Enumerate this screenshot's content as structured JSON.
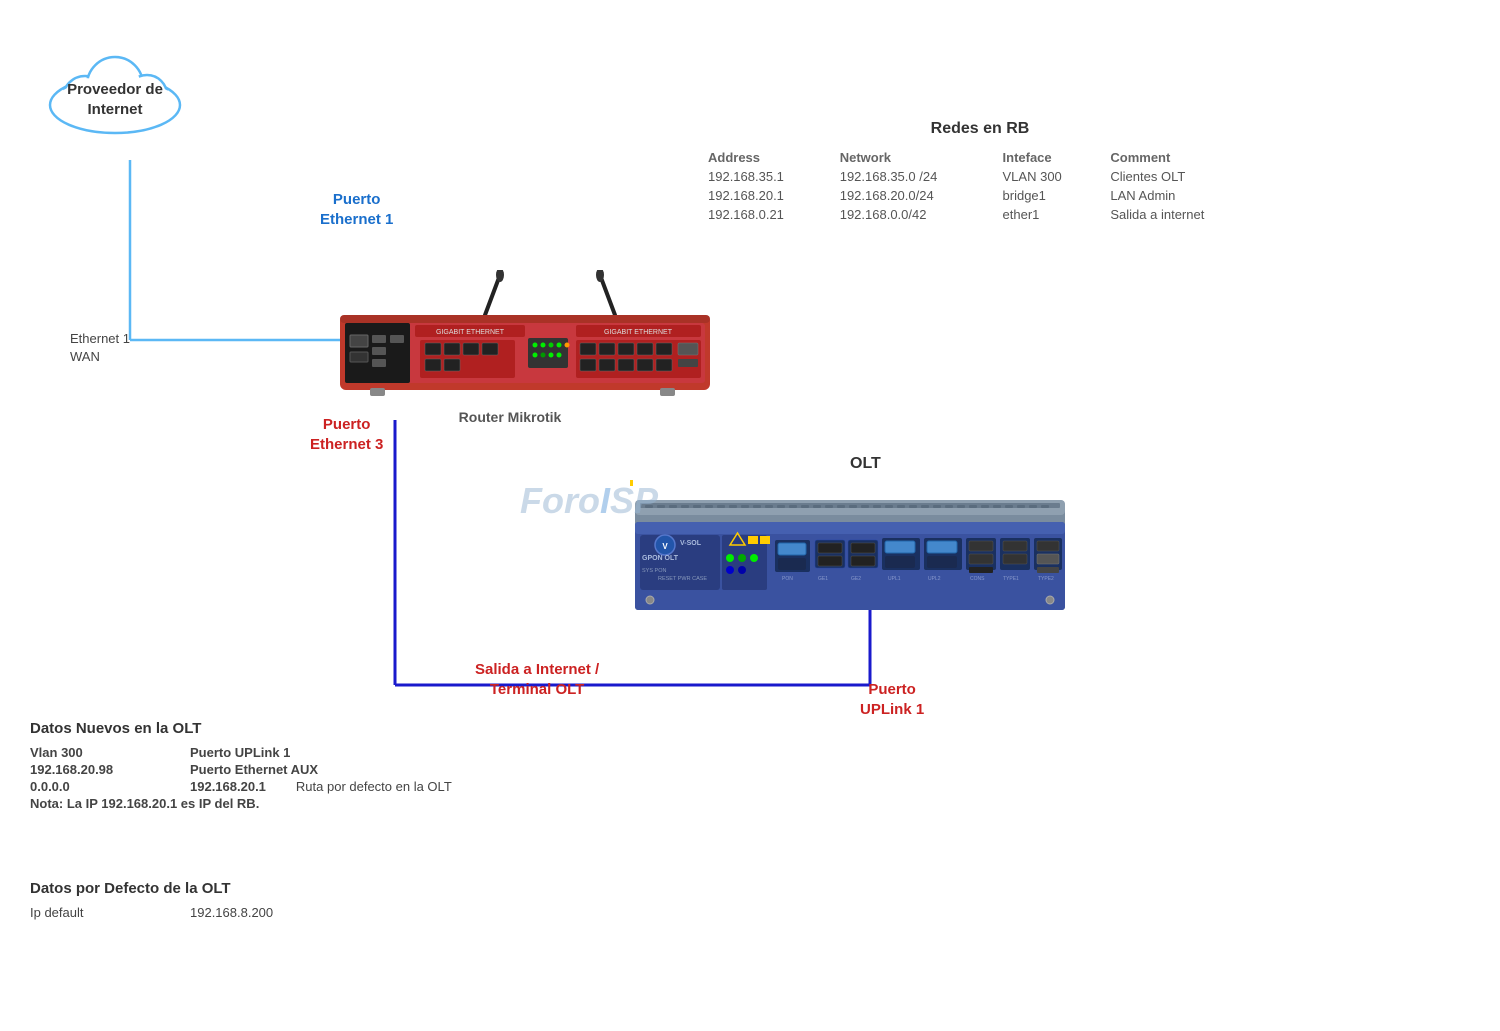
{
  "cloud": {
    "label_line1": "Proveedor de",
    "label_line2": "Internet"
  },
  "ethernet_wan": {
    "line1": "Ethernet 1",
    "line2": "WAN"
  },
  "labels": {
    "puerto_eth1_line1": "Puerto",
    "puerto_eth1_line2": "Ethernet 1",
    "puerto_eth3_line1": "Puerto",
    "puerto_eth3_line2": "Ethernet 3",
    "router_label": "Router Mikrotik",
    "olt_title": "OLT",
    "puerto_uplink_line1": "Puerto",
    "puerto_uplink_line2": "UPLink 1",
    "salida_line1": "Salida a Internet /",
    "salida_line2": "Terminal  OLT",
    "foro_text": "ForoISP",
    "watermark_prefix": "Foro",
    "watermark_suffix": "ISP"
  },
  "redes_rb": {
    "title": "Redes en RB",
    "headers": [
      "Address",
      "Network",
      "Inteface",
      "Comment"
    ],
    "rows": [
      [
        "192.168.35.1",
        "192.168.35.0 /24",
        "VLAN 300",
        "Clientes OLT"
      ],
      [
        "192.168.20.1",
        "192.168.20.0/24",
        "bridge1",
        "LAN Admin"
      ],
      [
        "192.168.0.21",
        "192.168.0.0/42",
        "ether1",
        "Salida a internet"
      ]
    ]
  },
  "datos_nuevos": {
    "title": "Datos Nuevos en  la OLT",
    "rows": [
      {
        "col1": "Vlan 300",
        "col2": "Puerto UPLink 1",
        "col3": ""
      },
      {
        "col1": "192.168.20.98",
        "col2": "Puerto Ethernet AUX",
        "col3": ""
      },
      {
        "col1": "0.0.0.0",
        "col2": "192.168.20.1",
        "col3": "Ruta  por defecto en la OLT"
      },
      {
        "col1": "Nota: La IP 192.168.20.1 es IP del RB.",
        "col2": "",
        "col3": ""
      }
    ]
  },
  "datos_defecto": {
    "title": "Datos por Defecto de la OLT",
    "rows": [
      {
        "label": "Ip default",
        "value": "192.168.8.200"
      }
    ]
  }
}
